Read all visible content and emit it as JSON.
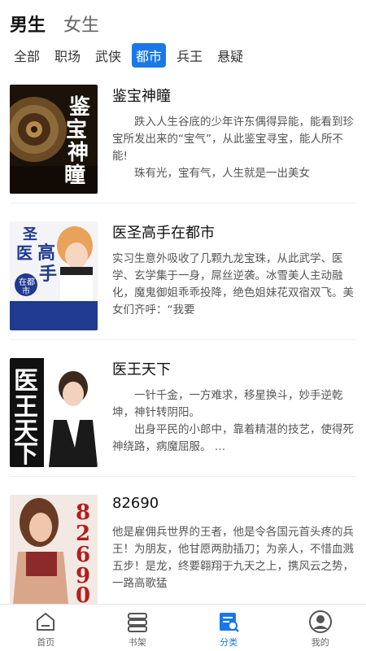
{
  "gender_tabs": [
    "男生",
    "女生"
  ],
  "categories": [
    "全部",
    "职场",
    "武侠",
    "都市",
    "兵王",
    "悬疑"
  ],
  "selected_category": "都市",
  "books": [
    {
      "title": "鉴宝神瞳",
      "cover_text": "鉴宝神瞳",
      "desc": [
        "　　跌入人生谷底的少年许东偶得异能，能看到珍宝所发出来的“宝气”，从此鉴宝寻宝，能人所不能!",
        "　　珠有光，宝有气，人生就是一出美女"
      ]
    },
    {
      "title": "医圣高手在都市",
      "cover_text": "圣医高手在都市",
      "desc": [
        "实习生意外吸收了几颗九龙宝珠，从此武学、医学、玄学集于一身，屌丝逆袭。冰雪美人主动融化，魔鬼御姐乖乖投降，绝色姐妹花双宿双飞。美女们齐呼：“我要"
      ]
    },
    {
      "title": "医王天下",
      "cover_text": "医王天下",
      "desc": [
        "　　一针千金，一方难求，移星换斗，妙手逆乾坤，神针转阴阳。",
        "　　出身平民的小郎中，靠着精湛的技艺，使得死神绕路，病魔屈服。 …"
      ]
    },
    {
      "title": "82690",
      "cover_text": "82690",
      "desc": [
        "他是雇佣兵世界的王者，他是令各国元首头疼的兵王！为朋友，他甘愿两肋插刀；为亲人，不惜血溅五步！是龙，终要翱翔于九天之上，携风云之势，一路高歌猛"
      ]
    }
  ],
  "nav": [
    "首页",
    "书架",
    "分类",
    "我的"
  ],
  "active_nav": "分类",
  "colors": {
    "accent": "#1a78e6"
  }
}
